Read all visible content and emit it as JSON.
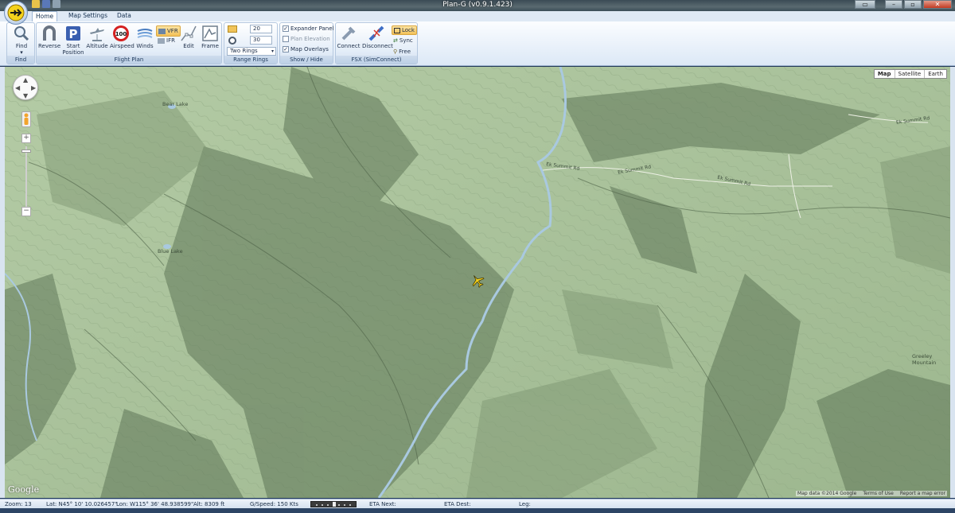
{
  "window": {
    "title": "Plan-G (v0.9.1.423)"
  },
  "tabs": [
    {
      "label": "Home",
      "active": true
    },
    {
      "label": "Map Settings",
      "active": false
    },
    {
      "label": "Data",
      "active": false
    }
  ],
  "ribbon": {
    "find": {
      "button": "Find",
      "group": "Find"
    },
    "flight_plan": {
      "group": "Flight Plan",
      "reverse": "Reverse",
      "start_position_1": "Start",
      "start_position_2": "Position",
      "altitude": "Altitude",
      "airspeed": "Airspeed",
      "airspeed_badge": "100",
      "winds": "Winds",
      "vfr": "VFR",
      "ifr": "IFR",
      "edit": "Edit",
      "frame": "Frame"
    },
    "range_rings": {
      "group": "Range Rings",
      "value1": "20",
      "value2": "30",
      "mode": "Two Rings"
    },
    "show_hide": {
      "group": "Show / Hide",
      "expander_panel": {
        "label": "Expander Panel",
        "checked": true
      },
      "plan_elevation": {
        "label": "Plan Elevation",
        "checked": false
      },
      "map_overlays": {
        "label": "Map Overlays",
        "checked": true
      }
    },
    "fsx": {
      "group": "FSX (SimConnect)",
      "connect": "Connect",
      "disconnect": "Disconnect",
      "lock": "Lock",
      "sync": "Sync",
      "free": "Free"
    }
  },
  "map": {
    "types": [
      "Map",
      "Satellite",
      "Earth"
    ],
    "selected_type": "Map",
    "labels": {
      "bear_lake": "Bear Lake",
      "blue_lake": "Blue Lake",
      "road1": "Ek Summit Rd",
      "road2": "Ek Summit Rd",
      "road3": "Ek Summit Rd",
      "road4": "Ek Summit Rd",
      "greeley": "Greeley Mountain"
    },
    "logo": "Google",
    "attribution": "Map data ©2014 Google",
    "terms": "Terms of Use",
    "report": "Report a map error"
  },
  "status": {
    "zoom": "Zoom: 13",
    "lat": "Lat: N45° 10' 10.026457\"",
    "lon": "Lon: W115° 36' 48.938599\"",
    "alt": "Alt: 8309 ft",
    "gspeed": "G/Speed: 150 Kts",
    "eta_next": "ETA Next:",
    "eta_dest": "ETA Dest:",
    "leg": "Leg:"
  },
  "colors": {
    "map_base": "#a8c29a",
    "ridge_dark": "#5f7658",
    "river": "#a9c9e0",
    "ribbon_blue": "#dce8f6"
  }
}
